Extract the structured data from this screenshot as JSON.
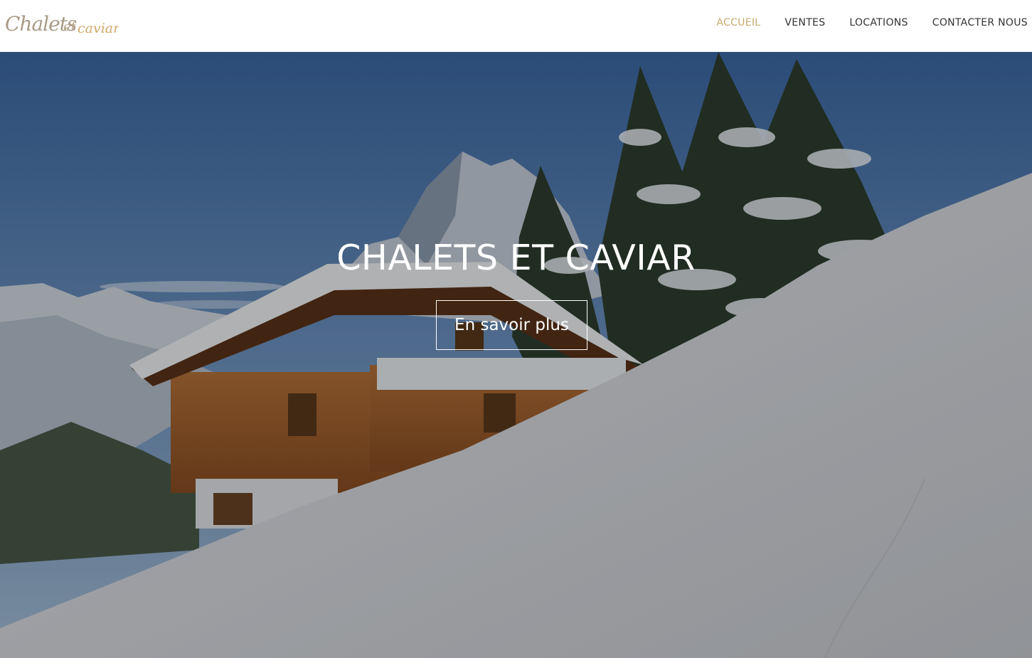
{
  "brand": {
    "logo_text": "Chalets et caviar"
  },
  "nav": {
    "items": [
      {
        "label": "ACCUEIL",
        "active": true
      },
      {
        "label": "VENTES",
        "active": false
      },
      {
        "label": "LOCATIONS",
        "active": false
      },
      {
        "label": "CONTACTER NOUS",
        "active": false
      }
    ]
  },
  "hero": {
    "title": "CHALETS ET CAVIAR",
    "cta_label": "En savoir plus",
    "image": "snowy-chalet-mountain-photo"
  },
  "colors": {
    "accent": "#c8a96b",
    "nav_text": "#333333",
    "hero_text": "#ffffff"
  }
}
